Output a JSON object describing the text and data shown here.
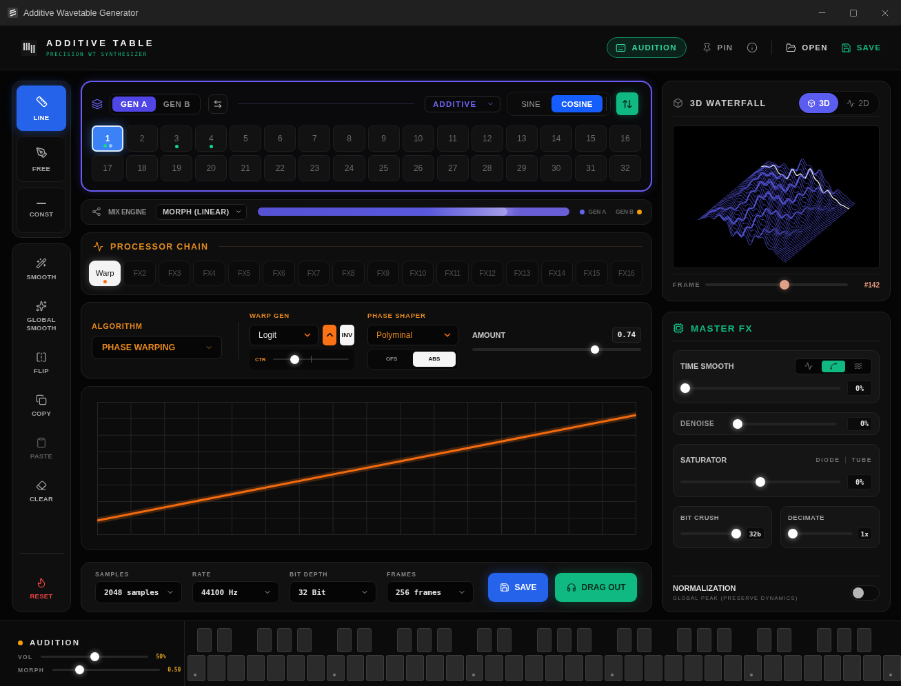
{
  "window": {
    "title": "Additive Wavetable Generator"
  },
  "header": {
    "brand": "ADDITIVE TABLE",
    "tagline": "PRECISION WT SYNTHESIZER",
    "audition_button": {
      "label": "AUDITION"
    },
    "pin_button": {
      "label": "PIN"
    },
    "open_button": {
      "label": "OPEN"
    },
    "save_button": {
      "label": "SAVE"
    }
  },
  "tools": {
    "draw_modes": [
      {
        "label": "LINE",
        "selected": true
      },
      {
        "label": "FREE",
        "selected": false
      },
      {
        "label": "CONST",
        "selected": false
      }
    ],
    "actions": [
      {
        "label": "SMOOTH",
        "disabled": false
      },
      {
        "label": "GLOBAL SMOOTH",
        "disabled": false
      },
      {
        "label": "FLIP",
        "disabled": false
      },
      {
        "label": "COPY",
        "disabled": false
      },
      {
        "label": "PASTE",
        "disabled": true
      },
      {
        "label": "CLEAR",
        "disabled": false
      }
    ],
    "reset_button": {
      "label": "RESET"
    }
  },
  "generator": {
    "sources": [
      {
        "label": "GEN A",
        "selected": true
      },
      {
        "label": "GEN B",
        "selected": false
      }
    ],
    "mode_dropdown": {
      "value": "ADDITIVE"
    },
    "basis": [
      {
        "label": "SINE",
        "selected": false
      },
      {
        "label": "COSINE",
        "selected": true
      }
    ],
    "slots": [
      {
        "label": "1",
        "selected": true,
        "filled": true
      },
      {
        "label": "2",
        "selected": false,
        "filled": false
      },
      {
        "label": "3",
        "selected": false,
        "filled": true
      },
      {
        "label": "4",
        "selected": false,
        "filled": true
      },
      {
        "label": "5",
        "selected": false,
        "filled": false
      },
      {
        "label": "6",
        "selected": false,
        "filled": false
      },
      {
        "label": "7",
        "selected": false,
        "filled": false
      },
      {
        "label": "8",
        "selected": false,
        "filled": false
      },
      {
        "label": "9",
        "selected": false,
        "filled": false
      },
      {
        "label": "10",
        "selected": false,
        "filled": false
      },
      {
        "label": "11",
        "selected": false,
        "filled": false
      },
      {
        "label": "12",
        "selected": false,
        "filled": false
      },
      {
        "label": "13",
        "selected": false,
        "filled": false
      },
      {
        "label": "14",
        "selected": false,
        "filled": false
      },
      {
        "label": "15",
        "selected": false,
        "filled": false
      },
      {
        "label": "16",
        "selected": false,
        "filled": false
      },
      {
        "label": "17",
        "selected": false,
        "filled": false
      },
      {
        "label": "18",
        "selected": false,
        "filled": false
      },
      {
        "label": "19",
        "selected": false,
        "filled": false
      },
      {
        "label": "20",
        "selected": false,
        "filled": false
      },
      {
        "label": "21",
        "selected": false,
        "filled": false
      },
      {
        "label": "22",
        "selected": false,
        "filled": false
      },
      {
        "label": "23",
        "selected": false,
        "filled": false
      },
      {
        "label": "24",
        "selected": false,
        "filled": false
      },
      {
        "label": "25",
        "selected": false,
        "filled": false
      },
      {
        "label": "26",
        "selected": false,
        "filled": false
      },
      {
        "label": "27",
        "selected": false,
        "filled": false
      },
      {
        "label": "28",
        "selected": false,
        "filled": false
      },
      {
        "label": "29",
        "selected": false,
        "filled": false
      },
      {
        "label": "30",
        "selected": false,
        "filled": false
      },
      {
        "label": "31",
        "selected": false,
        "filled": false
      },
      {
        "label": "32",
        "selected": false,
        "filled": false
      }
    ]
  },
  "mix_engine": {
    "label": "MIX ENGINE",
    "mode": "MORPH (LINEAR)",
    "level": 0.8,
    "legend": [
      {
        "label": "GEN A",
        "color": "#6366f1"
      },
      {
        "label": "GEN B",
        "color": "#f59e0b"
      }
    ]
  },
  "processor_chain": {
    "title": "PROCESSOR CHAIN",
    "slots": [
      {
        "label": "Warp",
        "selected": true,
        "active": true
      },
      {
        "label": "FX2",
        "selected": false,
        "active": false
      },
      {
        "label": "FX3",
        "selected": false,
        "active": false
      },
      {
        "label": "FX4",
        "selected": false,
        "active": false
      },
      {
        "label": "FX5",
        "selected": false,
        "active": false
      },
      {
        "label": "FX6",
        "selected": false,
        "active": false
      },
      {
        "label": "FX7",
        "selected": false,
        "active": false
      },
      {
        "label": "FX8",
        "selected": false,
        "active": false
      },
      {
        "label": "FX9",
        "selected": false,
        "active": false
      },
      {
        "label": "FX10",
        "selected": false,
        "active": false
      },
      {
        "label": "FX11",
        "selected": false,
        "active": false
      },
      {
        "label": "FX12",
        "selected": false,
        "active": false
      },
      {
        "label": "FX13",
        "selected": false,
        "active": false
      },
      {
        "label": "FX14",
        "selected": false,
        "active": false
      },
      {
        "label": "FX15",
        "selected": false,
        "active": false
      },
      {
        "label": "FX16",
        "selected": false,
        "active": false
      }
    ]
  },
  "processor_settings": {
    "algorithm": {
      "label": "ALGORITHM",
      "value": "PHASE WARPING"
    },
    "warp_gen": {
      "label": "WARP GEN",
      "value": "Logit",
      "curve_toggle": {
        "on": true
      },
      "invert": {
        "label": "INV",
        "on": true
      },
      "center": {
        "label": "CTR",
        "level": 0.25
      }
    },
    "phase_shaper": {
      "label": "PHASE SHAPER",
      "value": "Polyminal",
      "modes": [
        {
          "label": "OFS",
          "selected": false
        },
        {
          "label": "ABS",
          "selected": true
        }
      ]
    },
    "amount": {
      "label": "AMOUNT",
      "value": "0.74",
      "level": 0.74
    }
  },
  "export": {
    "fields": [
      {
        "label": "SAMPLES",
        "value": "2048 samples"
      },
      {
        "label": "RATE",
        "value": "44100 Hz"
      },
      {
        "label": "BIT DEPTH",
        "value": "32 Bit"
      },
      {
        "label": "FRAMES",
        "value": "256 frames"
      }
    ],
    "save_button": {
      "label": "SAVE"
    },
    "drag_out_button": {
      "label": "DRAG OUT"
    }
  },
  "waterfall": {
    "title": "3D WATERFALL",
    "views": [
      {
        "label": "3D",
        "selected": true
      },
      {
        "label": "2D",
        "selected": false
      }
    ],
    "frame": {
      "label": "FRAME",
      "level": 0.56,
      "value": "#142"
    }
  },
  "master_fx": {
    "title": "MASTER FX",
    "time_smooth": {
      "label": "TIME SMOOTH",
      "modes": [
        {
          "selected": false
        },
        {
          "selected": true
        },
        {
          "selected": false
        }
      ],
      "level": 0,
      "value": "0%"
    },
    "denoise": {
      "label": "DENOISE",
      "level": 0,
      "value": "0%"
    },
    "saturator": {
      "label": "SATURATOR",
      "types": [
        {
          "label": "DIODE",
          "selected": false
        },
        {
          "label": "TUBE",
          "selected": false
        }
      ],
      "level": 0.5,
      "value": "0%"
    },
    "bit_crush": {
      "label": "BIT CRUSH",
      "level": 1,
      "value": "32b"
    },
    "decimate": {
      "label": "DECIMATE",
      "level": 0,
      "value": "1x"
    },
    "normalization": {
      "label": "NORMALIZATION",
      "description": "GLOBAL PEAK (PRESERVE DYNAMICS)",
      "on": false
    }
  },
  "audition": {
    "title": "AUDITION",
    "on": true,
    "sliders": [
      {
        "label": "VOL",
        "level": 0.5,
        "value": "50%"
      },
      {
        "label": "MORPH",
        "level": 0.23,
        "value": "0.50"
      }
    ]
  }
}
